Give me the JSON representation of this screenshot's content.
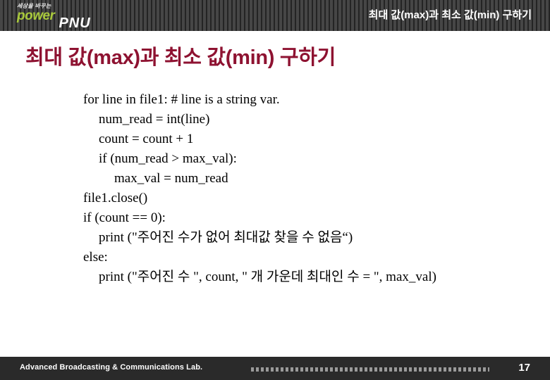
{
  "header": {
    "logo": {
      "tagline": "세상을 바꾸는",
      "power_text": "power",
      "pnu_text": "PNU"
    },
    "title": "최대 값(max)과 최소 값(min) 구하기"
  },
  "slide": {
    "title": "최대 값(max)과 최소 값(min) 구하기",
    "code_lines": [
      {
        "indent": 0,
        "text": "for line in file1: # line is a string var."
      },
      {
        "indent": 1,
        "text": "num_read = int(line)"
      },
      {
        "indent": 1,
        "text": "count = count + 1"
      },
      {
        "indent": 1,
        "text": "if (num_read > max_val):"
      },
      {
        "indent": 2,
        "text": "max_val = num_read"
      },
      {
        "indent": 0,
        "text": "file1.close()"
      },
      {
        "indent": 0,
        "text": "if (count == 0):"
      },
      {
        "indent": 1,
        "text": "print (\"주어진 수가 없어 최대값 찾을 수 없음“)"
      },
      {
        "indent": 0,
        "text": "else:"
      },
      {
        "indent": 1,
        "text": "print (\"주어진 수 \", count, \" 개 가운데 최대인 수 = \", max_val)"
      }
    ]
  },
  "footer": {
    "lab_name": "Advanced Broadcasting & Communications Lab.",
    "page_number": "17"
  },
  "colors": {
    "header_bg": "#2a2a2a",
    "title_maroon": "#8e1231",
    "logo_green": "#a9c93c",
    "footer_bg": "#2a2a2a",
    "body_bg": "#ffffff"
  }
}
